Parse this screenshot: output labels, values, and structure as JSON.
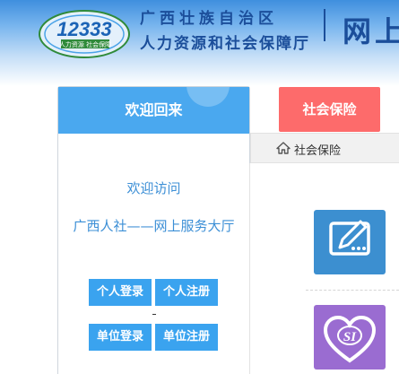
{
  "header": {
    "logo_number": "12333",
    "logo_subtitle": "人力资源 社会保障",
    "org_line1": "广西壮族自治区",
    "org_line2": "人力资源和社会保障厅",
    "site_title": "网上"
  },
  "welcome": {
    "title": "欢迎回来",
    "visit_text": "欢迎访问",
    "hall_text": "广西人社——网上服务大厅",
    "buttons": {
      "personal_login": "个人登录",
      "personal_register": "个人注册",
      "unit_login": "单位登录",
      "unit_register": "单位注册"
    }
  },
  "tab": {
    "social_insurance": "社会保险"
  },
  "breadcrumb": {
    "current": "社会保险"
  },
  "services": {
    "icon1": "edit-icon",
    "icon2": "si-heart-icon",
    "icon2_text": "SI"
  },
  "colors": {
    "header_blue": "#1b4e9a",
    "welcome_header": "#4aa8ef",
    "button_blue": "#3aa3ef",
    "tab_red": "#fd6b6b",
    "icon_blue": "#3c8fd0",
    "icon_purple": "#9a6cd1"
  }
}
